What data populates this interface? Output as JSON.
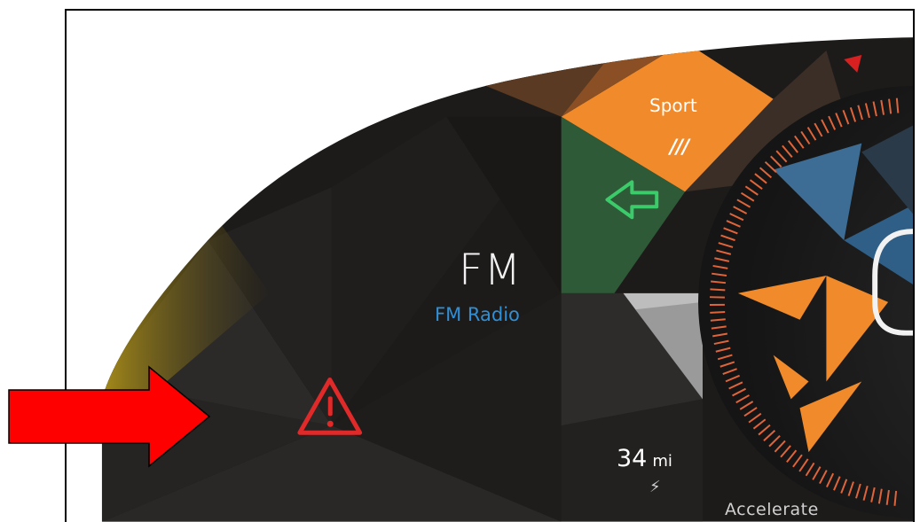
{
  "media": {
    "source_title": "FM",
    "source_subtitle": "FM Radio"
  },
  "drive_mode": {
    "label": "Sport",
    "indicator": "///"
  },
  "range": {
    "value": "34",
    "unit": "mi"
  },
  "speedometer": {
    "mode_label": "Accelerate"
  },
  "icons": {
    "turn_signal": "left-arrow-icon",
    "warning": "warning-triangle-icon",
    "regen": "charge-bolt-icon",
    "pointer": "red-arrow-icon"
  },
  "colors": {
    "warning": "#e02a2a",
    "turn_signal": "#3ccb6a",
    "accent_orange": "#f08a2a",
    "media_subtitle": "#2f8fd6",
    "pointer": "#ff0000"
  }
}
